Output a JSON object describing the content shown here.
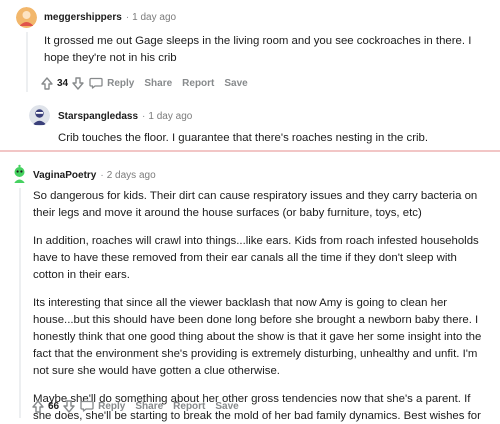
{
  "comments": [
    {
      "author": "meggershippers",
      "time": "1 day ago",
      "paragraphs": [
        "It grossed me out Gage sleeps in the living room and you see cockroaches in there. I hope they're not in his crib"
      ],
      "votes": "34",
      "actions": {
        "reply": "Reply",
        "share": "Share",
        "report": "Report",
        "save": "Save"
      }
    },
    {
      "author": "Starspangledass",
      "time": "1 day ago",
      "paragraphs": [
        "Crib touches the floor. I guarantee that there's roaches nesting in the crib."
      ]
    },
    {
      "author": "VaginaPoetry",
      "time": "2 days ago",
      "paragraphs": [
        "So dangerous for kids. Their dirt can cause respiratory issues and they carry bacteria on their legs and move it around the house surfaces (or baby furniture, toys, etc)",
        "In addition, roaches will crawl into things...like ears. Kids from roach infested households have to have these removed from their ear canals all the time if they don't sleep with cotton in their ears.",
        "Its interesting that since all the viewer backlash that now Amy is going to clean her house...but this should have been done long before she brought a newborn baby there. I honestly think that one good thing about the show is that it gave her some insight into the fact that the environment she's providing is extremely disturbing, unhealthy and unfit. I'm not sure she would have gotten a clue otherwise.",
        "Maybe she'll do something about her other gross tendencies now that she's a parent. If she does, she'll be starting to break the mold of her bad family dynamics. Best wishes for a better environment for her kid."
      ],
      "votes": "66",
      "actions": {
        "reply": "Reply",
        "share": "Share",
        "report": "Report",
        "save": "Save"
      }
    }
  ],
  "colors": {
    "avatar1": "#f2b76c",
    "avatar2": "#3a3f7a",
    "avatar3": "#46d160",
    "meta_gray": "#878a8c",
    "divider": "#f2c6c6"
  },
  "icons": [
    "upvote-icon",
    "downvote-icon",
    "reply-icon"
  ]
}
